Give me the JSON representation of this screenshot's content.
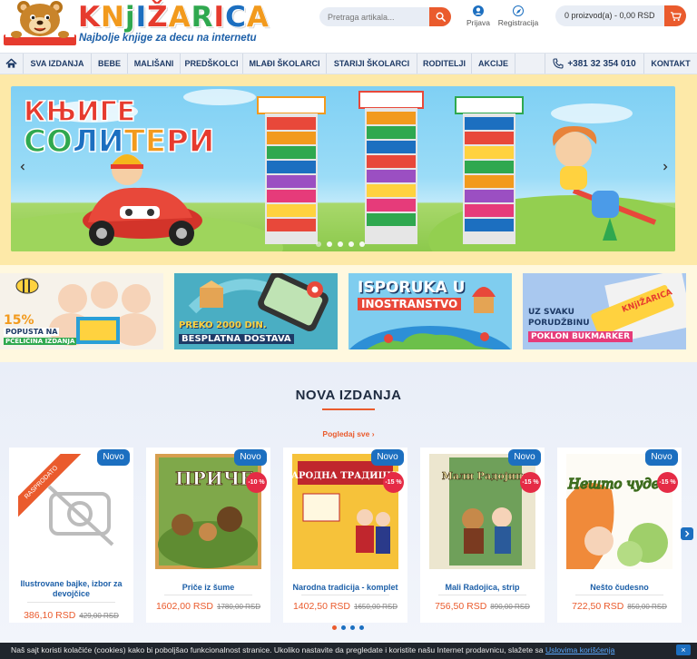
{
  "header": {
    "logo_title": "KNjIŽARICA",
    "logo_subtitle": "Najbolje knjige za decu na internetu",
    "search_placeholder": "Pretraga artikala...",
    "login_label": "Prijava",
    "register_label": "Registracija",
    "cart_label": "0 proizvod(a) - 0,00 RSD"
  },
  "nav": {
    "items": [
      "SVA IZDANJA",
      "BEBE",
      "MALIŠANI",
      "PREDŠKOLCI",
      "MLAĐI ŠKOLARCI",
      "STARIJI ŠKOLARCI",
      "RODITELJI",
      "AKCIJE"
    ],
    "phone": "+381 32 354 010",
    "contact": "KONTAKT"
  },
  "hero": {
    "title_line1": "КЊИГЕ",
    "title_line2": "СОЛИТЕРИ",
    "slide_count": 5
  },
  "promos": [
    {
      "line1": "15%",
      "line2": "POPUSTA NA",
      "line3": "PČELIČINA IZDANJA"
    },
    {
      "line1": "PREKO 2000 DIN.",
      "line2": "BESPLATNA DOSTAVA"
    },
    {
      "line1": "ISPORUKA U",
      "line2": "INOSTRANSTVO"
    },
    {
      "line1": "UZ SVAKU",
      "line2": "PORUDŽBINU",
      "line3": "POKLON BUKMARKER",
      "brand": "KNjIŽARICA"
    }
  ],
  "new_releases": {
    "title": "NOVA IZDANJA",
    "view_all": "Pogledaj sve",
    "badge_new": "Novo",
    "ribbon_text": "RASPRODATO",
    "products": [
      {
        "name": "Ilustrovane bajke, izbor za devojčice",
        "price": "386,10 RSD",
        "old_price": "429,00 RSD",
        "discount": "",
        "cover_title": ""
      },
      {
        "name": "Priče iz šume",
        "price": "1602,00 RSD",
        "old_price": "1780,00 RSD",
        "discount": "-10 %",
        "cover_title": "ПРИЧЕ"
      },
      {
        "name": "Narodna tradicija - komplet",
        "price": "1402,50 RSD",
        "old_price": "1650,00 RSD",
        "discount": "-15 %",
        "cover_title": "НАРОДНА ТРАДИЦИЈА"
      },
      {
        "name": "Mali Radojica, strip",
        "price": "756,50 RSD",
        "old_price": "890,00 RSD",
        "discount": "-15 %",
        "cover_title": "Мали Радојица"
      },
      {
        "name": "Nešto čudesno",
        "price": "722,50 RSD",
        "old_price": "850,00 RSD",
        "discount": "-15 %",
        "cover_title": "Нешто чудесно"
      }
    ]
  },
  "cookie": {
    "text": "Naš sajt koristi kolačiće (cookies) kako bi poboljšao funkcionalnost stranice. Ukoliko nastavite da pregledate i koristite našu Internet prodavnicu, slažete sa ",
    "link": "Uslovima korišćenja",
    "close": "×"
  }
}
